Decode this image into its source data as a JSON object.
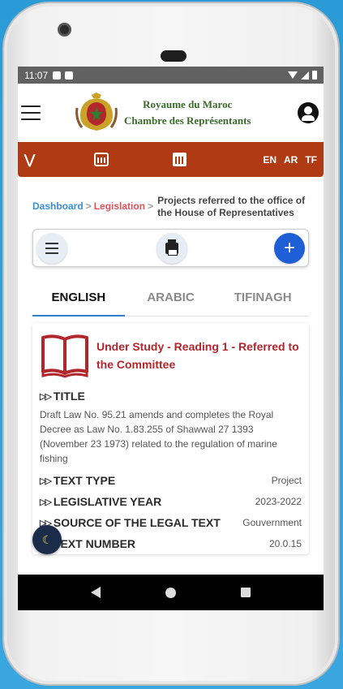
{
  "status_bar": {
    "time": "11:07"
  },
  "header": {
    "title_line1": "Royaume du Maroc",
    "title_line2": "Chambre des Représentants"
  },
  "nav_bar": {
    "languages": [
      "EN",
      "AR",
      "TF"
    ]
  },
  "breadcrumb": {
    "dashboard": "Dashboard",
    "legislation": "Legislation",
    "separator": ">",
    "current": "Projects referred to the office of the House of Representatives"
  },
  "tabs": [
    {
      "label": "ENGLISH",
      "active": true
    },
    {
      "label": "ARABIC",
      "active": false
    },
    {
      "label": "TIFINAGH",
      "active": false
    }
  ],
  "card": {
    "status": "Under Study - Reading 1 - Referred to the Committee",
    "title_label": "TITLE",
    "title_value": "Draft Law No. 95.21 amends and completes the Royal Decree as Law No. 1.83.255 of Shawwal 27 1393 (November 23 1973) related to the regulation of marine fishing",
    "fields": [
      {
        "label": "TEXT TYPE",
        "value": "Project"
      },
      {
        "label": "LEGISLATIVE YEAR",
        "value": "2023-2022"
      },
      {
        "label": "SOURCE OF THE LEGAL TEXT",
        "value": "Gouvernment"
      },
      {
        "label": "TEXT NUMBER",
        "value": "20.0.15"
      }
    ]
  },
  "colors": {
    "accent_red": "#b03a13",
    "brand_green": "#3a6b2a",
    "status_red": "#b3262c",
    "link_blue": "#3a8fd6"
  }
}
